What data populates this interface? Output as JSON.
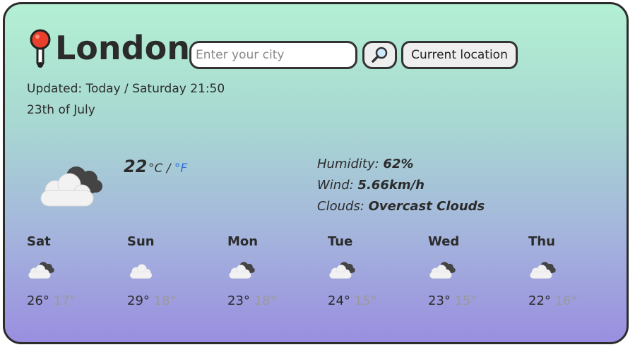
{
  "header": {
    "city": "London",
    "search_placeholder": "Enter your city",
    "search_value": "",
    "current_location_label": "Current location"
  },
  "updated": "Updated: Today / Saturday 21:50",
  "date": "23th of July",
  "current": {
    "temperature": "22",
    "unit_c": "°C",
    "separator": "/",
    "unit_f": "°F",
    "icon": "broken-clouds-icon",
    "humidity_label": "Humidity:",
    "humidity": "62%",
    "wind_label": "Wind:",
    "wind": "5.66km/h",
    "clouds_label": "Clouds:",
    "clouds": "Overcast Clouds"
  },
  "forecast": [
    {
      "day": "Sat",
      "max": "26°",
      "min": "17°",
      "icon": "broken-clouds-icon"
    },
    {
      "day": "Sun",
      "max": "29°",
      "min": "18°",
      "icon": "few-clouds-icon"
    },
    {
      "day": "Mon",
      "max": "23°",
      "min": "18°",
      "icon": "broken-clouds-icon"
    },
    {
      "day": "Tue",
      "max": "24°",
      "min": "15°",
      "icon": "broken-clouds-icon"
    },
    {
      "day": "Wed",
      "max": "23°",
      "min": "15°",
      "icon": "broken-clouds-icon"
    },
    {
      "day": "Thu",
      "max": "22°",
      "min": "16°",
      "icon": "broken-clouds-icon"
    }
  ],
  "colors": {
    "gradient_top": "#b3f0d3",
    "gradient_bottom": "#9a8ee0",
    "link_blue": "#2f6fd6",
    "min_temp_grey": "#9a9a9a"
  }
}
